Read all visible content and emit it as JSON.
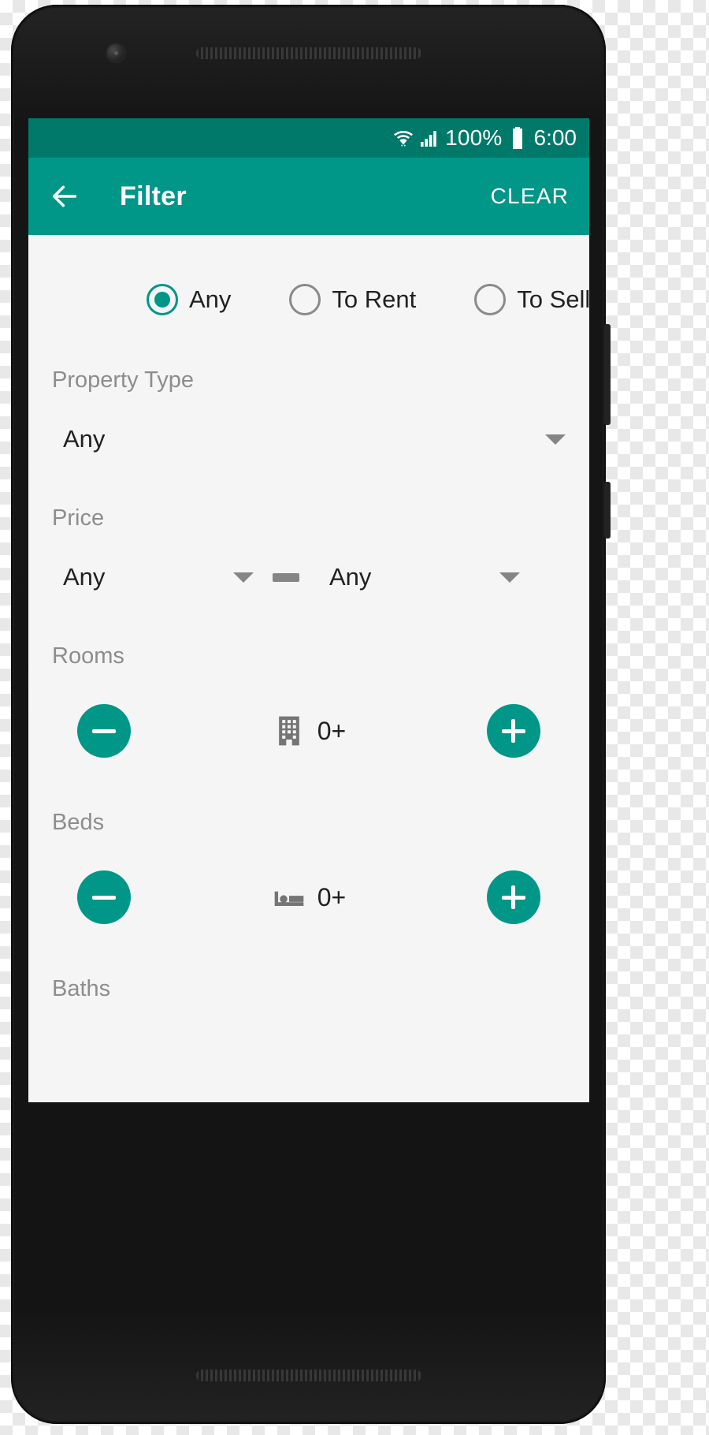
{
  "status_bar": {
    "wifi_icon": "wifi-icon",
    "signal_icon": "cellular-signal-icon",
    "battery_text": "100%",
    "battery_icon": "battery-full-icon",
    "time": "6:00",
    "bg_color": "#00796b"
  },
  "toolbar": {
    "back_icon": "arrow-left-icon",
    "title": "Filter",
    "clear_label": "CLEAR",
    "bg_color": "#009688"
  },
  "listing_type": {
    "options": [
      {
        "label": "Any",
        "checked": true
      },
      {
        "label": "To Rent",
        "checked": false
      },
      {
        "label": "To Sell",
        "checked": false
      }
    ]
  },
  "property_type": {
    "label": "Property Type",
    "value": "Any",
    "dropdown_icon": "chevron-down-icon"
  },
  "price": {
    "label": "Price",
    "min_value": "Any",
    "max_value": "Any",
    "separator": "dash-icon",
    "dropdown_icon": "chevron-down-icon"
  },
  "rooms": {
    "label": "Rooms",
    "count": "0+",
    "icon": "building-icon",
    "minus_icon": "minus-icon",
    "plus_icon": "plus-icon"
  },
  "beds": {
    "label": "Beds",
    "count": "0+",
    "icon": "bed-icon",
    "minus_icon": "minus-icon",
    "plus_icon": "plus-icon"
  },
  "baths": {
    "label": "Baths"
  },
  "theme": {
    "accent": "#009688",
    "accent_dark": "#00796b",
    "content_bg": "#f5f5f5",
    "label_gray": "#8d8d8d",
    "text_dark": "#212121",
    "icon_gray": "#757575"
  }
}
